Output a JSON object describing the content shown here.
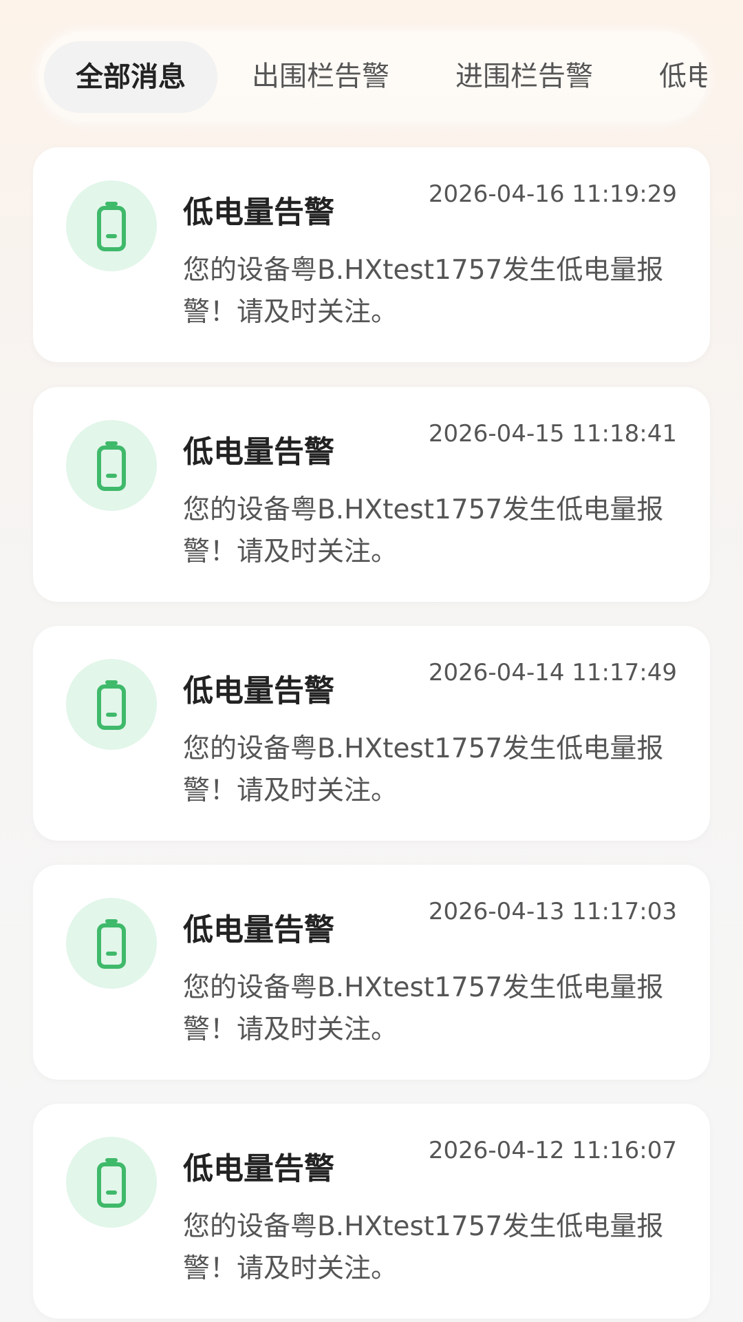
{
  "tabs": [
    {
      "label": "全部消息",
      "active": true
    },
    {
      "label": "出围栏告警",
      "active": false
    },
    {
      "label": "进围栏告警",
      "active": false
    },
    {
      "label": "低电",
      "active": false
    }
  ],
  "messages": [
    {
      "icon": "battery-low-icon",
      "title": "低电量告警",
      "time": "2026-04-16 11:19:29",
      "body": "您的设备粤B.HXtest1757发生低电量报警！请及时关注。"
    },
    {
      "icon": "battery-low-icon",
      "title": "低电量告警",
      "time": "2026-04-15 11:18:41",
      "body": "您的设备粤B.HXtest1757发生低电量报警！请及时关注。"
    },
    {
      "icon": "battery-low-icon",
      "title": "低电量告警",
      "time": "2026-04-14 11:17:49",
      "body": "您的设备粤B.HXtest1757发生低电量报警！请及时关注。"
    },
    {
      "icon": "battery-low-icon",
      "title": "低电量告警",
      "time": "2026-04-13 11:17:03",
      "body": "您的设备粤B.HXtest1757发生低电量报警！请及时关注。"
    },
    {
      "icon": "battery-low-icon",
      "title": "低电量告警",
      "time": "2026-04-12 11:16:07",
      "body": "您的设备粤B.HXtest1757发生低电量报警！请及时关注。"
    }
  ],
  "colors": {
    "accent_green": "#3fb96a",
    "icon_bg": "#e2f6ea"
  }
}
